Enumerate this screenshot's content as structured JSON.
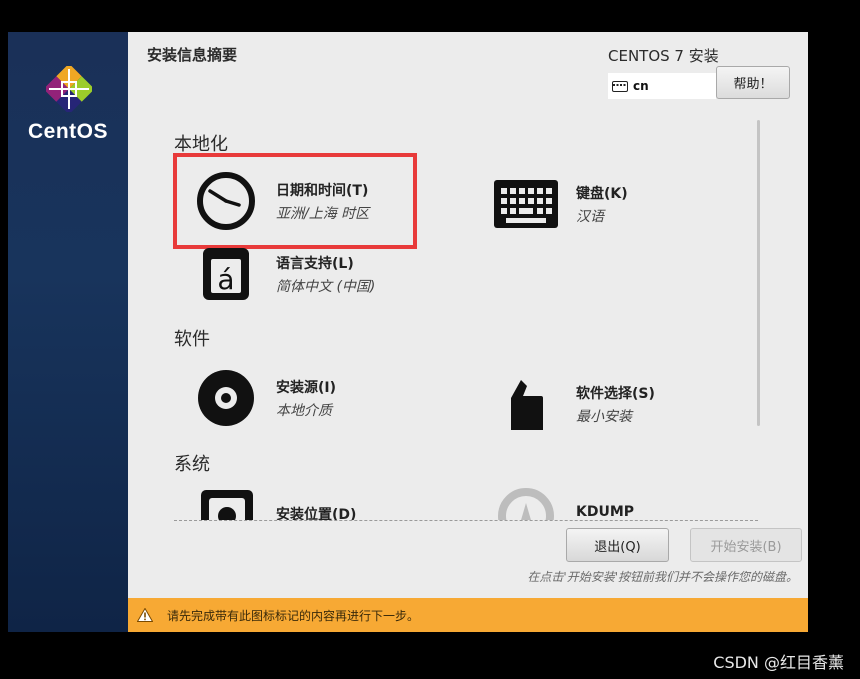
{
  "sidebar": {
    "brand": "CentOS",
    "logo_icon": "centos-logo-icon"
  },
  "header": {
    "title": "安装信息摘要",
    "product": "CENTOS 7 安装",
    "keyboard_layout": "cn",
    "help_label": "帮助！"
  },
  "sections": {
    "localization": "本地化",
    "software": "软件",
    "system": "系统"
  },
  "spokes": {
    "datetime": {
      "title": "日期和时间(T)",
      "status": "亚洲/上海 时区",
      "icon": "clock-icon"
    },
    "keyboard": {
      "title": "键盘(K)",
      "status": "汉语",
      "icon": "keyboard-icon"
    },
    "language": {
      "title": "语言支持(L)",
      "status": "简体中文 (中国)",
      "icon": "language-icon"
    },
    "source": {
      "title": "安装源(I)",
      "status": "本地介质",
      "icon": "disc-icon"
    },
    "software": {
      "title": "软件选择(S)",
      "status": "最小安装",
      "icon": "package-icon"
    },
    "destination": {
      "title": "安装位置(D)",
      "icon": "disk-icon"
    },
    "kdump": {
      "title": "KDUMP",
      "icon": "kdump-icon"
    }
  },
  "buttons": {
    "quit": "退出(Q)",
    "begin": "开始安装(B)"
  },
  "note": "在点击'开始安装'按钮前我们并不会操作您的磁盘。",
  "warning": {
    "text": "请先完成带有此图标标记的内容再进行下一步。",
    "icon": "warning-icon"
  },
  "watermark": "CSDN @红目香薰",
  "colors": {
    "sidebar": "#1a3058",
    "warning_bar": "#f7a934",
    "highlight": "#e83a3a",
    "background": "#ececec"
  }
}
